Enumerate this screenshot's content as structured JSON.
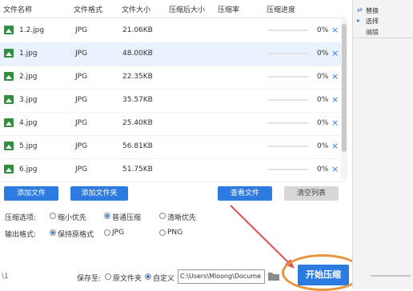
{
  "table": {
    "headers": [
      "文件名称",
      "文件格式",
      "文件大小",
      "压缩后大小",
      "压缩率",
      "压缩进度"
    ],
    "rows": [
      {
        "name": "1.2.jpg",
        "format": "JPG",
        "size": "21.06KB",
        "progress": 0,
        "pct": "0%"
      },
      {
        "name": "1.jpg",
        "format": "JPG",
        "size": "48.00KB",
        "progress": 0,
        "pct": "0%"
      },
      {
        "name": "2.jpg",
        "format": "JPG",
        "size": "22.35KB",
        "progress": 0,
        "pct": "0%"
      },
      {
        "name": "3.jpg",
        "format": "JPG",
        "size": "35.57KB",
        "progress": 0,
        "pct": "0%"
      },
      {
        "name": "4.jpg",
        "format": "JPG",
        "size": "25.40KB",
        "progress": 0,
        "pct": "0%"
      },
      {
        "name": "5.jpg",
        "format": "JPG",
        "size": "56.81KB",
        "progress": 0,
        "pct": "0%"
      },
      {
        "name": "6.jpg",
        "format": "JPG",
        "size": "51.75KB",
        "progress": 0,
        "pct": "0%"
      }
    ],
    "remove_glyph": "×"
  },
  "actions": {
    "add_file": "添加文件",
    "add_folder": "添加文件夹",
    "view_file": "查看文件",
    "clear_list": "清空列表"
  },
  "compress": {
    "label": "压缩选项:",
    "options": [
      "缩小优先",
      "普通压缩",
      "清晰优先"
    ],
    "selected": "普通压缩"
  },
  "output": {
    "label": "输出格式:",
    "options": [
      "保持原格式",
      "JPG",
      "PNG"
    ],
    "selected": "保持原格式"
  },
  "save": {
    "label": "保存至:",
    "options": [
      "原文件夹",
      "自定义"
    ],
    "selected": "自定义",
    "path": "C:\\Users\\Mloong\\Docume"
  },
  "start_label": "开始压缩",
  "left_edge_text": "\\1",
  "right_panel": {
    "replace": "替换",
    "select": "选择",
    "edit": "编辑"
  },
  "colors": {
    "accent": "#2d7be0",
    "highlight_ring": "#e8953a",
    "arrow": "#d9534f"
  }
}
